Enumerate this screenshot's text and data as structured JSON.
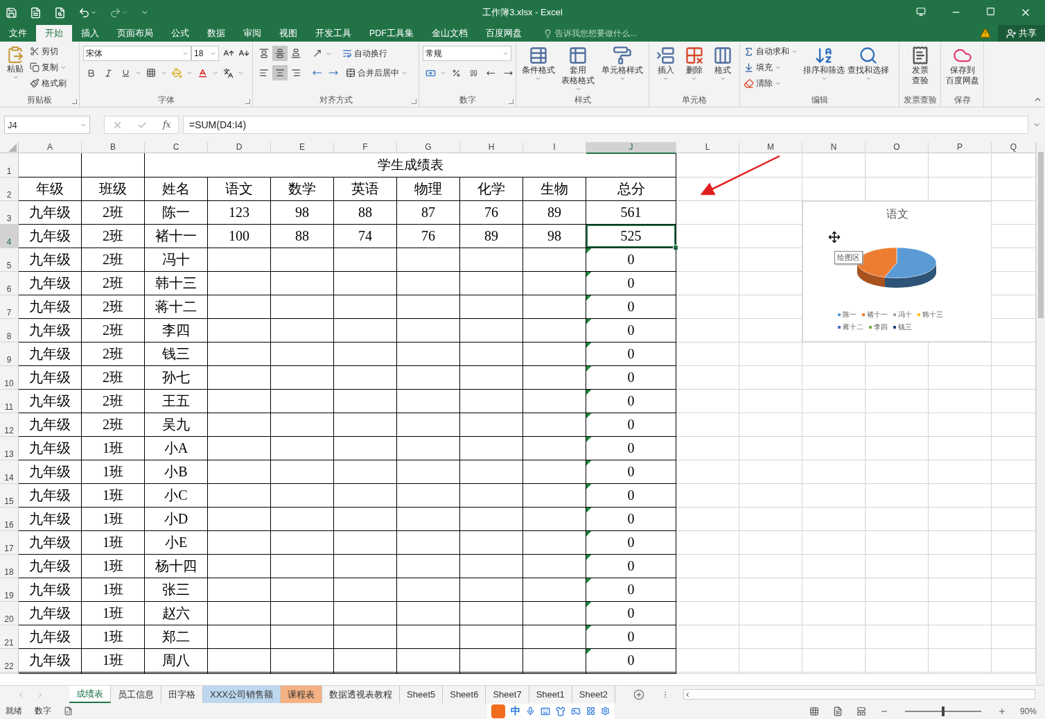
{
  "window": {
    "title": "工作簿3.xlsx - Excel"
  },
  "menu_tabs": [
    {
      "label": "文件",
      "selected": false
    },
    {
      "label": "开始",
      "selected": true
    },
    {
      "label": "插入",
      "selected": false
    },
    {
      "label": "页面布局",
      "selected": false
    },
    {
      "label": "公式",
      "selected": false
    },
    {
      "label": "数据",
      "selected": false
    },
    {
      "label": "审阅",
      "selected": false
    },
    {
      "label": "视图",
      "selected": false
    },
    {
      "label": "开发工具",
      "selected": false
    },
    {
      "label": "PDF工具集",
      "selected": false
    },
    {
      "label": "金山文档",
      "selected": false
    },
    {
      "label": "百度网盘",
      "selected": false
    }
  ],
  "tell_me": {
    "placeholder": "告诉我您想要做什么..."
  },
  "share": "共享",
  "ribbon": {
    "clipboard": {
      "label": "剪贴板",
      "paste": "粘贴",
      "items": [
        "剪切",
        "复制",
        "格式刷"
      ]
    },
    "font": {
      "label": "字体",
      "font_name": "宋体",
      "font_size": "18"
    },
    "alignment": {
      "label": "对齐方式",
      "wrap": "自动换行",
      "merge": "合并后居中",
      "vertical": [
        {
          "kind": "top",
          "selected": false
        },
        {
          "kind": "middle",
          "selected": true
        },
        {
          "kind": "bottom",
          "selected": false
        }
      ],
      "horizontal": [
        {
          "kind": "left",
          "selected": false
        },
        {
          "kind": "center",
          "selected": true
        },
        {
          "kind": "right",
          "selected": false
        }
      ]
    },
    "number": {
      "label": "数字",
      "format": "常规"
    },
    "styles": {
      "label": "样式",
      "items": [
        [
          "条件格式"
        ],
        [
          "套用",
          "表格格式"
        ],
        [
          "单元格样式"
        ]
      ]
    },
    "cells": {
      "label": "单元格",
      "items": [
        "插入",
        "删除",
        "格式"
      ]
    },
    "editing": {
      "label": "编辑",
      "small": [
        "自动求和",
        "填充",
        "清除"
      ],
      "large": [
        "排序和筛选",
        "查找和选择"
      ]
    },
    "invoice": {
      "label": "发票查验",
      "button": [
        "发票",
        "查验"
      ]
    },
    "save": {
      "label": "保存",
      "button": [
        "保存到",
        "百度网盘"
      ]
    }
  },
  "formula_bar": {
    "name_box": "J4",
    "function_label": "fx",
    "formula": "=SUM(D4:I4)"
  },
  "columns": [
    {
      "label": "A",
      "selected": false
    },
    {
      "label": "B",
      "selected": false
    },
    {
      "label": "C",
      "selected": false
    },
    {
      "label": "D",
      "selected": false
    },
    {
      "label": "E",
      "selected": false
    },
    {
      "label": "F",
      "selected": false
    },
    {
      "label": "G",
      "selected": false
    },
    {
      "label": "H",
      "selected": false
    },
    {
      "label": "I",
      "selected": false
    },
    {
      "label": "J",
      "selected": true
    },
    {
      "label": "L",
      "selected": false
    },
    {
      "label": "M",
      "selected": false
    },
    {
      "label": "N",
      "selected": false
    },
    {
      "label": "O",
      "selected": false
    },
    {
      "label": "P",
      "selected": false
    },
    {
      "label": "Q",
      "selected": false
    }
  ],
  "sheet": {
    "title_row": {
      "row": "1",
      "title": "学生成绩表"
    },
    "header_row": {
      "row": "2",
      "cells": [
        "年级",
        "班级",
        "姓名",
        "语文",
        "数学",
        "英语",
        "物理",
        "化学",
        "生物",
        "总分"
      ]
    },
    "rows": [
      {
        "row": "3",
        "grade": "九年级",
        "class": "2班",
        "name": "陈一",
        "scores": [
          "123",
          "98",
          "88",
          "87",
          "76",
          "89"
        ],
        "total": "561",
        "flag": false,
        "selected": false
      },
      {
        "row": "4",
        "grade": "九年级",
        "class": "2班",
        "name": "褚十一",
        "scores": [
          "100",
          "88",
          "74",
          "76",
          "89",
          "98"
        ],
        "total": "525",
        "flag": false,
        "selected": true
      },
      {
        "row": "5",
        "grade": "九年级",
        "class": "2班",
        "name": "冯十",
        "total": "0",
        "flag": true,
        "selected": false
      },
      {
        "row": "6",
        "grade": "九年级",
        "class": "2班",
        "name": "韩十三",
        "total": "0",
        "flag": true,
        "selected": false
      },
      {
        "row": "7",
        "grade": "九年级",
        "class": "2班",
        "name": "蒋十二",
        "total": "0",
        "flag": true,
        "selected": false
      },
      {
        "row": "8",
        "grade": "九年级",
        "class": "2班",
        "name": "李四",
        "total": "0",
        "flag": true,
        "selected": false
      },
      {
        "row": "9",
        "grade": "九年级",
        "class": "2班",
        "name": "钱三",
        "total": "0",
        "flag": true,
        "selected": false
      },
      {
        "row": "10",
        "grade": "九年级",
        "class": "2班",
        "name": "孙七",
        "total": "0",
        "flag": true,
        "selected": false
      },
      {
        "row": "11",
        "grade": "九年级",
        "class": "2班",
        "name": "王五",
        "total": "0",
        "flag": true,
        "selected": false
      },
      {
        "row": "12",
        "grade": "九年级",
        "class": "2班",
        "name": "吴九",
        "total": "0",
        "flag": true,
        "selected": false
      },
      {
        "row": "13",
        "grade": "九年级",
        "class": "1班",
        "name": "小A",
        "total": "0",
        "flag": true,
        "selected": false
      },
      {
        "row": "14",
        "grade": "九年级",
        "class": "1班",
        "name": "小B",
        "total": "0",
        "flag": true,
        "selected": false
      },
      {
        "row": "15",
        "grade": "九年级",
        "class": "1班",
        "name": "小C",
        "total": "0",
        "flag": true,
        "selected": false
      },
      {
        "row": "16",
        "grade": "九年级",
        "class": "1班",
        "name": "小D",
        "total": "0",
        "flag": true,
        "selected": false
      },
      {
        "row": "17",
        "grade": "九年级",
        "class": "1班",
        "name": "小E",
        "total": "0",
        "flag": true,
        "selected": false
      },
      {
        "row": "18",
        "grade": "九年级",
        "class": "1班",
        "name": "杨十四",
        "total": "0",
        "flag": true,
        "selected": false
      },
      {
        "row": "19",
        "grade": "九年级",
        "class": "1班",
        "name": "张三",
        "total": "0",
        "flag": true,
        "selected": false
      },
      {
        "row": "20",
        "grade": "九年级",
        "class": "1班",
        "name": "赵六",
        "total": "0",
        "flag": true,
        "selected": false
      },
      {
        "row": "21",
        "grade": "九年级",
        "class": "1班",
        "name": "郑二",
        "total": "0",
        "flag": true,
        "selected": false
      },
      {
        "row": "22",
        "grade": "九年级",
        "class": "1班",
        "name": "周八",
        "total": "0",
        "flag": true,
        "selected": false
      }
    ]
  },
  "chart": {
    "title": "语文",
    "tooltip": "绘图区",
    "legend": [
      {
        "label": "陈一",
        "color": "#5b9bd5"
      },
      {
        "label": "褚十一",
        "color": "#ed7d31"
      },
      {
        "label": "冯十",
        "color": "#a5a5a5"
      },
      {
        "label": "韩十三",
        "color": "#ffc000"
      },
      {
        "label": "蒋十二",
        "color": "#4472c4"
      },
      {
        "label": "李四",
        "color": "#70ad47"
      },
      {
        "label": "钱三",
        "color": "#264478"
      }
    ]
  },
  "sheet_tabs": [
    {
      "label": "成绩表",
      "selected": true
    },
    {
      "label": "员工信息",
      "selected": false
    },
    {
      "label": "田字格",
      "selected": false
    },
    {
      "label": "XXX公司销售额",
      "selected": false,
      "color": "#bdd7ee"
    },
    {
      "label": "课程表",
      "selected": false,
      "color": "#f4b183"
    },
    {
      "label": "数据透视表教程",
      "selected": false
    },
    {
      "label": "Sheet5",
      "selected": false
    },
    {
      "label": "Sheet6",
      "selected": false
    },
    {
      "label": "Sheet7",
      "selected": false
    },
    {
      "label": "Sheet1",
      "selected": false
    },
    {
      "label": "Sheet2",
      "selected": false
    }
  ],
  "status_bar": {
    "items": [
      "就绪",
      "数字"
    ],
    "ime": "中",
    "zoom_slider": {
      "level": 0.5
    },
    "zoom": "90%"
  }
}
